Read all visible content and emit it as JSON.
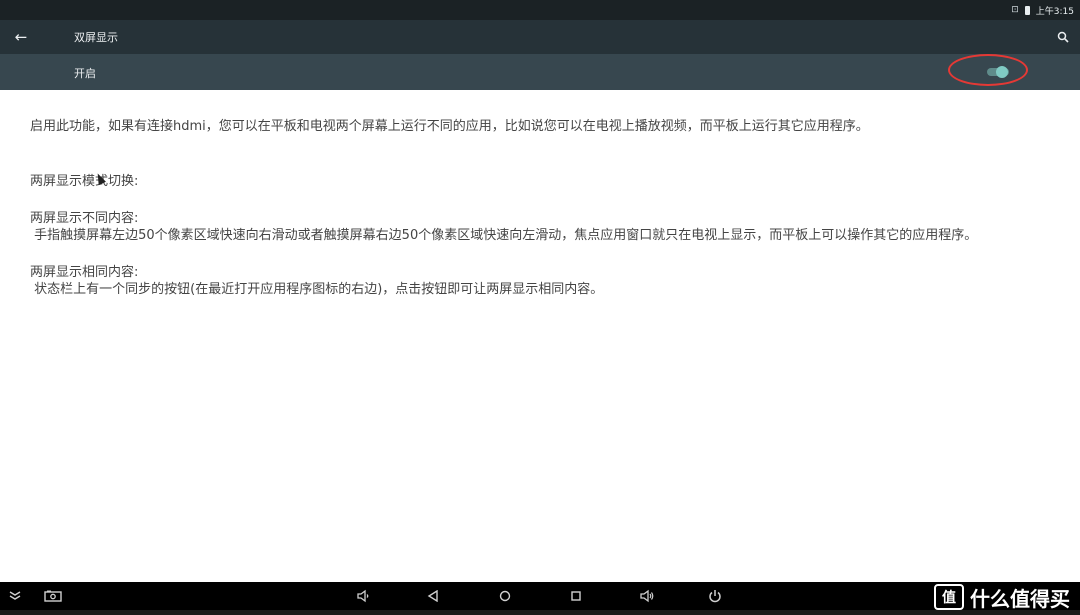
{
  "status_bar": {
    "time": "上午3:15",
    "icons": [
      "notification-icon",
      "battery-icon"
    ]
  },
  "app_bar": {
    "title": "双屏显示",
    "back_icon": "arrow-left-icon",
    "search_icon": "search-icon"
  },
  "switch_bar": {
    "label": "开启",
    "toggle_state": "on",
    "accent": "#80cbc4",
    "highlight_color": "#e53935"
  },
  "content": {
    "intro": "启用此功能，如果有连接hdmi，您可以在平板和电视两个屏幕上运行不同的应用，比如说您可以在电视上播放视频，而平板上运行其它应用程序。",
    "mode_heading": "两屏显示模式切换:",
    "different_heading": "两屏显示不同内容:",
    "different_body": " 手指触摸屏幕左边50个像素区域快速向右滑动或者触摸屏幕右边50个像素区域快速向左滑动，焦点应用窗口就只在电视上显示，而平板上可以操作其它的应用程序。",
    "same_heading": "两屏显示相同内容:",
    "same_body": " 状态栏上有一个同步的按钮(在最近打开应用程序图标的右边)，点击按钮即可让两屏显示相同内容。"
  },
  "nav_bar": {
    "icons": [
      "collapse-icon",
      "screenshot-icon",
      "volume-down-icon",
      "back-icon",
      "home-icon",
      "recents-icon",
      "volume-up-icon",
      "power-icon"
    ]
  },
  "watermark": {
    "logo_glyph": "值",
    "text": "什么值得买"
  },
  "colors": {
    "app_bar": "#263238",
    "switch_bar": "#37474f",
    "nav_bar": "#000000",
    "text": "#444444"
  }
}
